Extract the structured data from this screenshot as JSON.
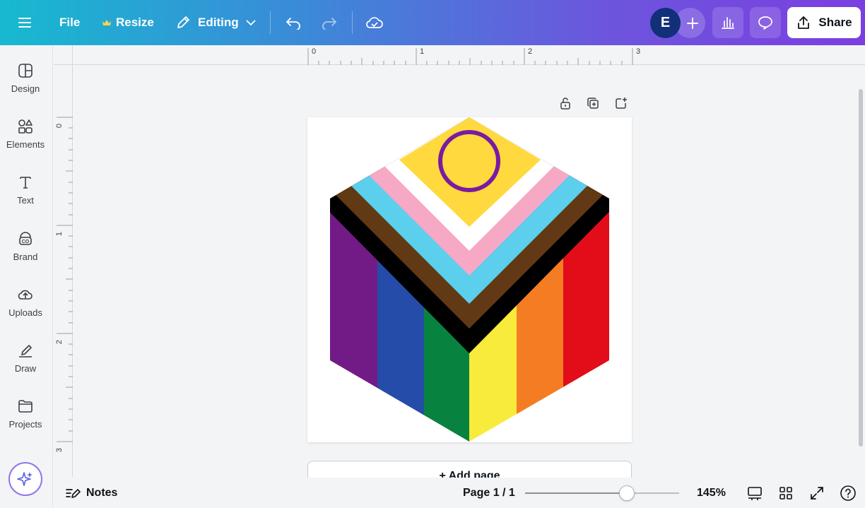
{
  "topbar": {
    "menu_icon": "hamburger-icon",
    "file_label": "File",
    "resize_label": "Resize",
    "editing_label": "Editing",
    "avatar_initial": "E",
    "share_label": "Share"
  },
  "sidebar": {
    "items": [
      {
        "label": "Design",
        "icon": "design-icon"
      },
      {
        "label": "Elements",
        "icon": "elements-icon"
      },
      {
        "label": "Text",
        "icon": "text-icon"
      },
      {
        "label": "Brand",
        "icon": "brand-icon"
      },
      {
        "label": "Uploads",
        "icon": "uploads-icon"
      },
      {
        "label": "Draw",
        "icon": "draw-icon"
      },
      {
        "label": "Projects",
        "icon": "projects-icon"
      }
    ]
  },
  "rulers": {
    "top": [
      "0",
      "1",
      "2",
      "3"
    ],
    "left": [
      "0",
      "1",
      "2",
      "3"
    ]
  },
  "canvas": {
    "add_page_label": "+ Add page",
    "flag_colors": {
      "yellow": "#ffd93d",
      "purple_ring": "#7a1aa3",
      "white": "#ffffff",
      "pink": "#f7a8c4",
      "light_blue": "#5bcfec",
      "brown": "#613915",
      "black": "#000000",
      "purple": "#721b87",
      "blue": "#254ca8",
      "green": "#08833f",
      "rainbow_yellow": "#f8eb3c",
      "orange": "#f47d24",
      "red": "#e20d19"
    }
  },
  "bottombar": {
    "notes_label": "Notes",
    "page_indicator": "Page 1 / 1",
    "zoom_label": "145%",
    "zoom_level_fraction": 0.66
  }
}
